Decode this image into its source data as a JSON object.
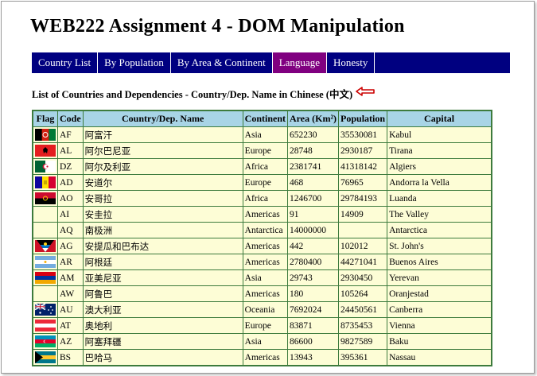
{
  "page": {
    "title": "WEB222 Assignment 4 - DOM  Manipulation"
  },
  "nav": {
    "items": [
      {
        "label": "Country List"
      },
      {
        "label": "By Population"
      },
      {
        "label": "By Area & Continent"
      },
      {
        "label": "Language"
      },
      {
        "label": "Honesty"
      }
    ],
    "active_label": "Language"
  },
  "subheading": "List of Countries and Dependencies - Country/Dep. Name in Chinese (中文)",
  "arrow_icon": "left-arrow-icon",
  "table": {
    "headers": {
      "flag": "Flag",
      "code": "Code",
      "name": "Country/Dep. Name",
      "continent": "Continent",
      "area": "Area (Km²)",
      "population": "Population",
      "capital": "Capital"
    },
    "rows": [
      {
        "flag": "af",
        "code": "AF",
        "name": "阿富汗",
        "continent": "Asia",
        "area": "652230",
        "population": "35530081",
        "capital": "Kabul"
      },
      {
        "flag": "al",
        "code": "AL",
        "name": "阿尔巴尼亚",
        "continent": "Europe",
        "area": "28748",
        "population": "2930187",
        "capital": "Tirana"
      },
      {
        "flag": "dz",
        "code": "DZ",
        "name": "阿尔及利亚",
        "continent": "Africa",
        "area": "2381741",
        "population": "41318142",
        "capital": "Algiers"
      },
      {
        "flag": "ad",
        "code": "AD",
        "name": "安道尔",
        "continent": "Europe",
        "area": "468",
        "population": "76965",
        "capital": "Andorra la Vella"
      },
      {
        "flag": "ao",
        "code": "AO",
        "name": "安哥拉",
        "continent": "Africa",
        "area": "1246700",
        "population": "29784193",
        "capital": "Luanda"
      },
      {
        "flag": "",
        "code": "AI",
        "name": "安圭拉",
        "continent": "Americas",
        "area": "91",
        "population": "14909",
        "capital": "The Valley"
      },
      {
        "flag": "",
        "code": "AQ",
        "name": "南极洲",
        "continent": "Antarctica",
        "area": "14000000",
        "population": "",
        "capital": "Antarctica"
      },
      {
        "flag": "ag",
        "code": "AG",
        "name": "安提瓜和巴布达",
        "continent": "Americas",
        "area": "442",
        "population": "102012",
        "capital": "St. John's"
      },
      {
        "flag": "ar",
        "code": "AR",
        "name": "阿根廷",
        "continent": "Americas",
        "area": "2780400",
        "population": "44271041",
        "capital": "Buenos Aires"
      },
      {
        "flag": "am",
        "code": "AM",
        "name": "亚美尼亚",
        "continent": "Asia",
        "area": "29743",
        "population": "2930450",
        "capital": "Yerevan"
      },
      {
        "flag": "",
        "code": "AW",
        "name": "阿鲁巴",
        "continent": "Americas",
        "area": "180",
        "population": "105264",
        "capital": "Oranjestad"
      },
      {
        "flag": "au",
        "code": "AU",
        "name": "澳大利亚",
        "continent": "Oceania",
        "area": "7692024",
        "population": "24450561",
        "capital": "Canberra"
      },
      {
        "flag": "at",
        "code": "AT",
        "name": "奥地利",
        "continent": "Europe",
        "area": "83871",
        "population": "8735453",
        "capital": "Vienna"
      },
      {
        "flag": "az",
        "code": "AZ",
        "name": "阿塞拜疆",
        "continent": "Asia",
        "area": "86600",
        "population": "9827589",
        "capital": "Baku"
      },
      {
        "flag": "bs",
        "code": "BS",
        "name": "巴哈马",
        "continent": "Americas",
        "area": "13943",
        "population": "395361",
        "capital": "Nassau"
      }
    ]
  },
  "colors": {
    "nav_bg": "#000080",
    "nav_active": "#800080",
    "header_bg": "#a8d4e6",
    "cell_bg": "#fdfdd6",
    "border": "#3d7b3d",
    "arrow": "#cc0000"
  }
}
